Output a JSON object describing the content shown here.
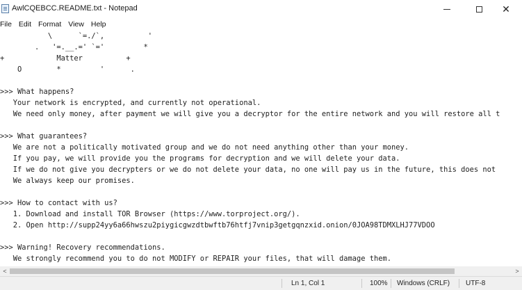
{
  "window": {
    "title": "AwlCQEBCC.README.txt - Notepad",
    "controls": {
      "minimize": "",
      "maximize": "",
      "close": "✕"
    }
  },
  "menu": [
    "File",
    "Edit",
    "Format",
    "View",
    "Help"
  ],
  "document": {
    "lines": [
      "           \\      `=./`,          '",
      "        .   '=.__.=' `='         *",
      "+            Matter          +",
      "    O        *         '      .",
      "",
      ">>> What happens?",
      "   Your network is encrypted, and currently not operational.",
      "   We need only money, after payment we will give you a decryptor for the entire network and you will restore all t",
      "",
      ">>> What guarantees?",
      "   We are not a politically motivated group and we do not need anything other than your money.",
      "   If you pay, we will provide you the programs for decryption and we will delete your data.",
      "   If we do not give you decrypters or we do not delete your data, no one will pay us in the future, this does not",
      "   We always keep our promises.",
      "",
      ">>> How to contact with us?",
      "   1. Download and install TOR Browser (https://www.torproject.org/).",
      "   2. Open http://supp24yy6a66hwszu2piygicgwzdtbwftb76htfj7vnip3getgqnzxid.onion/0JOA98TDMXLHJ77VDOO",
      "",
      ">>> Warning! Recovery recommendations.",
      "   We strongly recommend you to do not MODIFY or REPAIR your files, that will damage them."
    ]
  },
  "scrollbar": {
    "left": "<",
    "right": ">"
  },
  "status": {
    "position": "Ln 1, Col 1",
    "zoom": "100%",
    "line_ending": "Windows (CRLF)",
    "encoding": "UTF-8"
  }
}
